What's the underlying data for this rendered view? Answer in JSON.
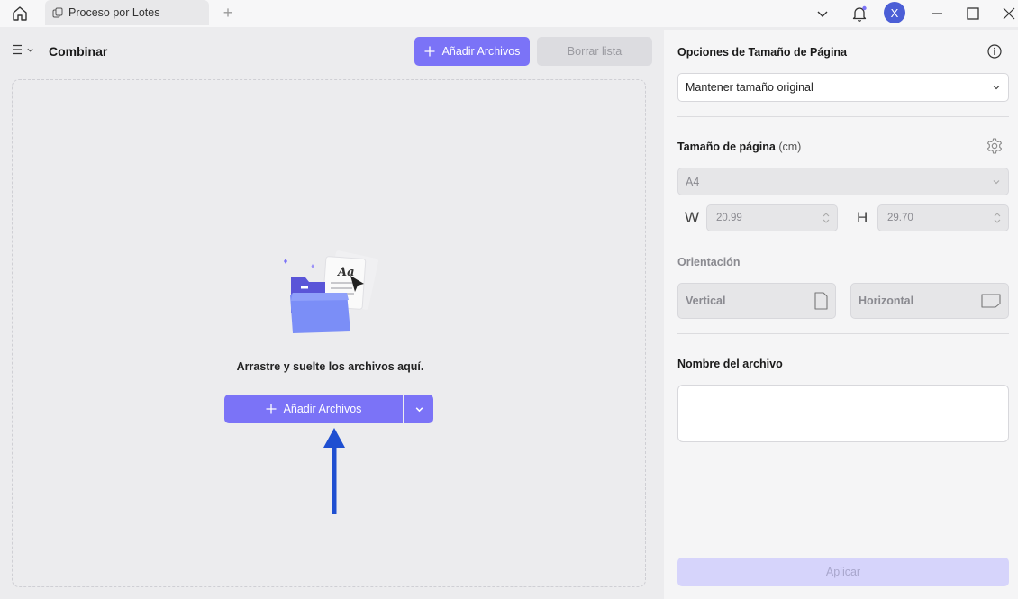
{
  "titlebar": {
    "tab_label": "Proceso por Lotes",
    "new_tab_symbol": "+",
    "avatar_initial": "X"
  },
  "left": {
    "title": "Combinar",
    "add_files_label": "Añadir Archivos",
    "clear_list_label": "Borrar lista",
    "drop_text": "Arrastre y suelte los archivos aquí.",
    "add_files_main_label": "Añadir Archivos"
  },
  "right": {
    "page_size_options_title": "Opciones de Tamaño de Página",
    "page_size_option_value": "Mantener tamaño original",
    "page_size_title": "Tamaño de página",
    "page_size_unit": "(cm)",
    "paper_value": "A4",
    "width_label": "W",
    "width_value": "20.99",
    "height_label": "H",
    "height_value": "29.70",
    "orientation_title": "Orientación",
    "vertical_label": "Vertical",
    "horizontal_label": "Horizontal",
    "filename_title": "Nombre del archivo",
    "filename_value": "",
    "apply_label": "Aplicar"
  },
  "colors": {
    "accent": "#7b73f7",
    "avatar": "#4b5ed6",
    "annotation_arrow": "#1f4fd1"
  },
  "icons": [
    "home-icon",
    "tab-icon",
    "chevron-down-icon",
    "bell-icon",
    "minimize-icon",
    "maximize-icon",
    "close-icon",
    "hamburger-icon",
    "plus-icon",
    "info-icon",
    "gear-icon",
    "portrait-icon",
    "landscape-icon"
  ]
}
